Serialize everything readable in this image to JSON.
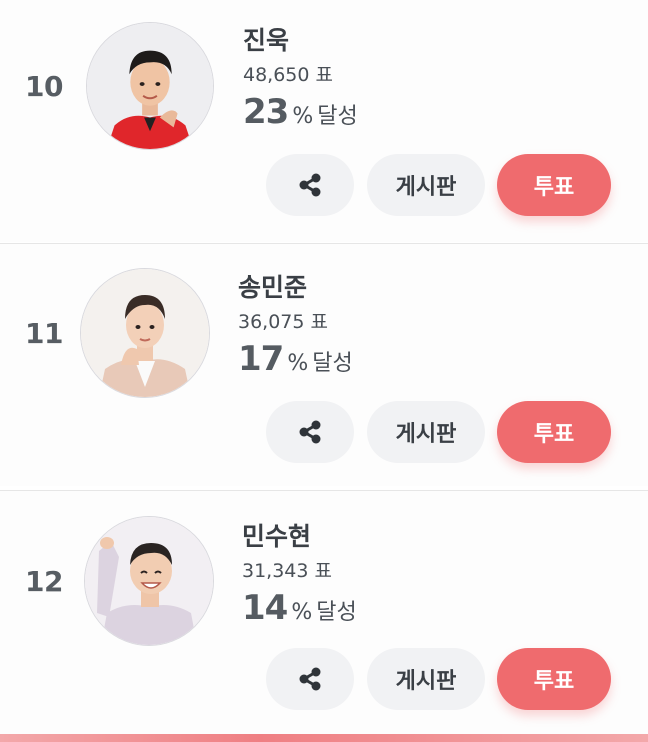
{
  "entries": [
    {
      "rank": "10",
      "name": "진욱",
      "votes": "48,650 표",
      "percent": "23",
      "percent_unit": "%",
      "percent_label": "달성",
      "share_icon": "share-icon",
      "board_label": "게시판",
      "vote_label": "투표"
    },
    {
      "rank": "11",
      "name": "송민준",
      "votes": "36,075 표",
      "percent": "17",
      "percent_unit": "%",
      "percent_label": "달성",
      "share_icon": "share-icon",
      "board_label": "게시판",
      "vote_label": "투표"
    },
    {
      "rank": "12",
      "name": "민수현",
      "votes": "31,343 표",
      "percent": "14",
      "percent_unit": "%",
      "percent_label": "달성",
      "share_icon": "share-icon",
      "board_label": "게시판",
      "vote_label": "투표"
    }
  ],
  "colors": {
    "vote_button": "#ef6b6e",
    "secondary_button": "#f1f2f4",
    "text_dark": "#3a3f45"
  }
}
